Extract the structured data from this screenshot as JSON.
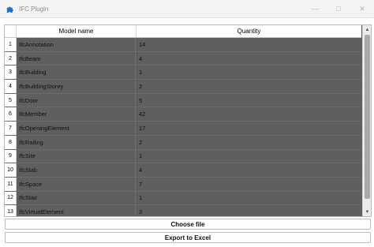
{
  "window": {
    "title": "IFC Plugin"
  },
  "table": {
    "columns": [
      "Model name",
      "Quantity"
    ],
    "rows": [
      {
        "num": "1",
        "name": "IfcAnnotation",
        "qty": "14"
      },
      {
        "num": "2",
        "name": "IfcBeam",
        "qty": "4"
      },
      {
        "num": "3",
        "name": "IfcBuilding",
        "qty": "1"
      },
      {
        "num": "4",
        "name": "IfcBuildingStorey",
        "qty": "2"
      },
      {
        "num": "5",
        "name": "IfcDoor",
        "qty": "5"
      },
      {
        "num": "6",
        "name": "IfcMember",
        "qty": "42"
      },
      {
        "num": "7",
        "name": "IfcOpeningElement",
        "qty": "17"
      },
      {
        "num": "8",
        "name": "IfcRailing",
        "qty": "2"
      },
      {
        "num": "9",
        "name": "IfcSite",
        "qty": "1"
      },
      {
        "num": "10",
        "name": "IfcSlab",
        "qty": "4"
      },
      {
        "num": "11",
        "name": "IfcSpace",
        "qty": "7"
      },
      {
        "num": "12",
        "name": "IfcStair",
        "qty": "1"
      },
      {
        "num": "13",
        "name": "IfcVirtualElement",
        "qty": "3"
      }
    ]
  },
  "buttons": {
    "choose_file": "Choose file",
    "export_excel": "Export to Excel"
  },
  "icons": {
    "app": "puzzle-icon",
    "minimize": "minimize-icon",
    "maximize": "maximize-icon",
    "close": "close-icon"
  }
}
